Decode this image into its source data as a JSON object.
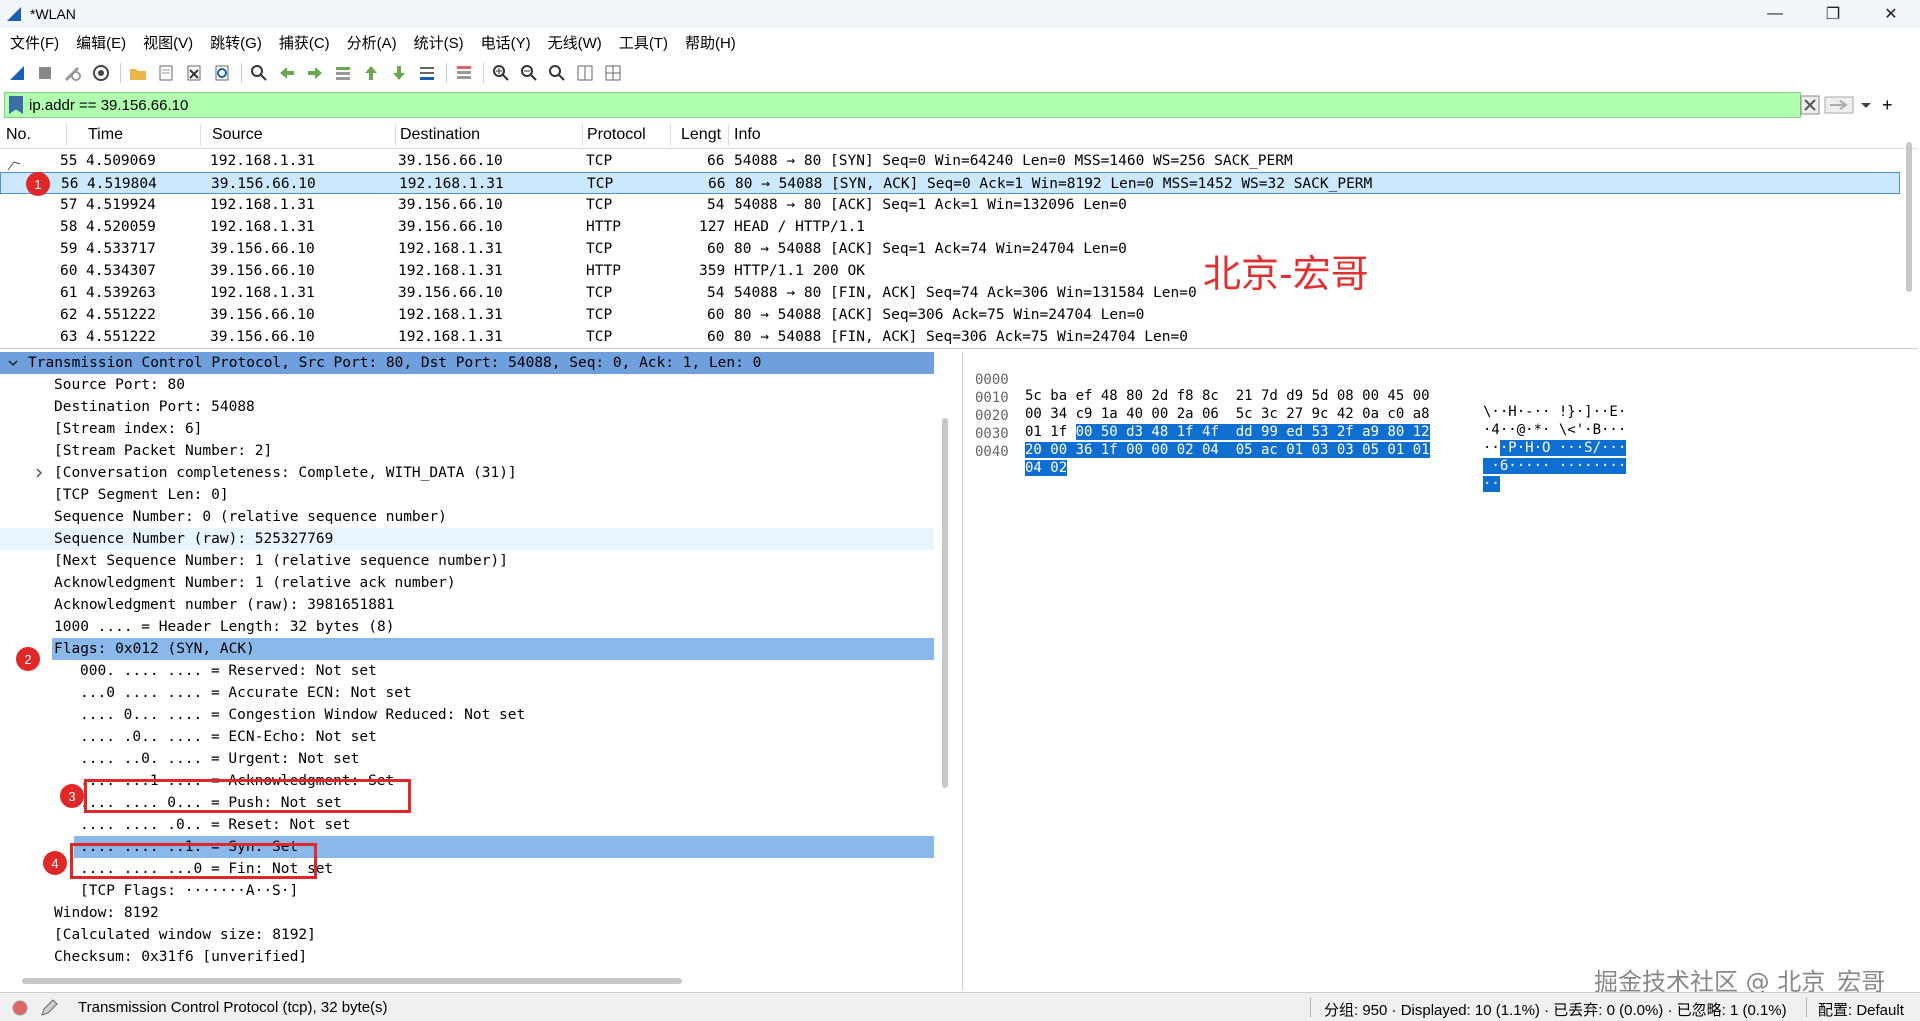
{
  "window": {
    "title": "*WLAN",
    "minimize": "—",
    "restore": "❐",
    "close": "✕"
  },
  "menu": [
    "文件(F)",
    "编辑(E)",
    "视图(V)",
    "跳转(G)",
    "捕获(C)",
    "分析(A)",
    "统计(S)",
    "电话(Y)",
    "无线(W)",
    "工具(T)",
    "帮助(H)"
  ],
  "filter": {
    "value": "ip.addr == 39.156.66.10",
    "add_label": "+"
  },
  "columns": [
    "No.",
    "Time",
    "Source",
    "Destination",
    "Protocol",
    "Lengt",
    "Info"
  ],
  "packets": [
    {
      "no": "55",
      "time": "4.509069",
      "src": "192.168.1.31",
      "dst": "39.156.66.10",
      "proto": "TCP",
      "len": "66",
      "info": "54088 → 80 [SYN] Seq=0 Win=64240 Len=0 MSS=1460 WS=256 SACK_PERM"
    },
    {
      "no": "56",
      "time": "4.519804",
      "src": "39.156.66.10",
      "dst": "192.168.1.31",
      "proto": "TCP",
      "len": "66",
      "info": "80 → 54088 [SYN, ACK] Seq=0 Ack=1 Win=8192 Len=0 MSS=1452 WS=32 SACK_PERM"
    },
    {
      "no": "57",
      "time": "4.519924",
      "src": "192.168.1.31",
      "dst": "39.156.66.10",
      "proto": "TCP",
      "len": "54",
      "info": "54088 → 80 [ACK] Seq=1 Ack=1 Win=132096 Len=0"
    },
    {
      "no": "58",
      "time": "4.520059",
      "src": "192.168.1.31",
      "dst": "39.156.66.10",
      "proto": "HTTP",
      "len": "127",
      "info": "HEAD / HTTP/1.1"
    },
    {
      "no": "59",
      "time": "4.533717",
      "src": "39.156.66.10",
      "dst": "192.168.1.31",
      "proto": "TCP",
      "len": "60",
      "info": "80 → 54088 [ACK] Seq=1 Ack=74 Win=24704 Len=0"
    },
    {
      "no": "60",
      "time": "4.534307",
      "src": "39.156.66.10",
      "dst": "192.168.1.31",
      "proto": "HTTP",
      "len": "359",
      "info": "HTTP/1.1 200 OK"
    },
    {
      "no": "61",
      "time": "4.539263",
      "src": "192.168.1.31",
      "dst": "39.156.66.10",
      "proto": "TCP",
      "len": "54",
      "info": "54088 → 80 [FIN, ACK] Seq=74 Ack=306 Win=131584 Len=0"
    },
    {
      "no": "62",
      "time": "4.551222",
      "src": "39.156.66.10",
      "dst": "192.168.1.31",
      "proto": "TCP",
      "len": "60",
      "info": "80 → 54088 [ACK] Seq=306 Ack=75 Win=24704 Len=0"
    },
    {
      "no": "63",
      "time": "4.551222",
      "src": "39.156.66.10",
      "dst": "192.168.1.31",
      "proto": "TCP",
      "len": "60",
      "info": "80 → 54088 [FIN, ACK] Seq=306 Ack=75 Win=24704 Len=0"
    }
  ],
  "watermark_red": "北京-宏哥",
  "details": [
    "Transmission Control Protocol, Src Port: 80, Dst Port: 54088, Seq: 0, Ack: 1, Len: 0",
    "Source Port: 80",
    "Destination Port: 54088",
    "[Stream index: 6]",
    "[Stream Packet Number: 2]",
    "[Conversation completeness: Complete, WITH_DATA (31)]",
    "[TCP Segment Len: 0]",
    "Sequence Number: 0    (relative sequence number)",
    "Sequence Number (raw): 525327769",
    "[Next Sequence Number: 1    (relative sequence number)]",
    "Acknowledgment Number: 1    (relative ack number)",
    "Acknowledgment number (raw): 3981651881",
    "1000 .... = Header Length: 32 bytes (8)",
    "Flags: 0x012 (SYN, ACK)",
    "000. .... .... = Reserved: Not set",
    "...0 .... .... = Accurate ECN: Not set",
    ".... 0... .... = Congestion Window Reduced: Not set",
    ".... .0.. .... = ECN-Echo: Not set",
    ".... ..0. .... = Urgent: Not set",
    ".... ...1 .... = Acknowledgment: Set",
    ".... .... 0... = Push: Not set",
    ".... .... .0.. = Reset: Not set",
    ".... .... ..1. = Syn: Set",
    ".... .... ...0 = Fin: Not set",
    "[TCP Flags: ·······A··S·]",
    "Window: 8192",
    "[Calculated window size: 8192]",
    "Checksum: 0x31f6 [unverified]"
  ],
  "bytes": [
    {
      "off": "0000",
      "hex_plain": "5c ba ef 48 80 2d f8 8c  21 7d d9 5d 08 00 45 00",
      "hex_sel": "",
      "ascii_plain": "\\··H·-·· !}·]··E·",
      "ascii_sel": ""
    },
    {
      "off": "0010",
      "hex_plain": "00 34 c9 1a 40 00 2a 06  5c 3c 27 9c 42 0a c0 a8",
      "hex_sel": "",
      "ascii_plain": "·4··@·*· \\<'·B···",
      "ascii_sel": ""
    },
    {
      "off": "0020",
      "hex_plain": "01 1f ",
      "hex_sel": "00 50 d3 48 1f 4f  dd 99 ed 53 2f a9 80 12",
      "ascii_plain": "··",
      "ascii_sel": "·P·H·O ···S/···"
    },
    {
      "off": "0030",
      "hex_plain": "",
      "hex_sel": "20 00 36 1f 00 00 02 04  05 ac 01 03 03 05 01 01",
      "ascii_plain": "",
      "ascii_sel": " ·6····· ········"
    },
    {
      "off": "0040",
      "hex_plain": "",
      "hex_sel": "04 02",
      "ascii_plain": "",
      "ascii_sel": "··"
    }
  ],
  "watermark_grey": "掘金技术社区 @ 北京_宏哥",
  "status": {
    "proto_info": "Transmission Control Protocol (tcp), 32 byte(s)",
    "counts": "分组: 950 · Displayed: 10 (1.1%) · 已丢弃: 0 (0.0%) · 已忽略: 1 (0.1%)",
    "profile": "配置: Default"
  },
  "annotations": [
    "1",
    "2",
    "3",
    "4"
  ],
  "colors": {
    "selected_row": "#cce8ff",
    "filter_ok": "#afffaf",
    "highlight": "#8ab8ea",
    "annotation": "#e02828"
  }
}
